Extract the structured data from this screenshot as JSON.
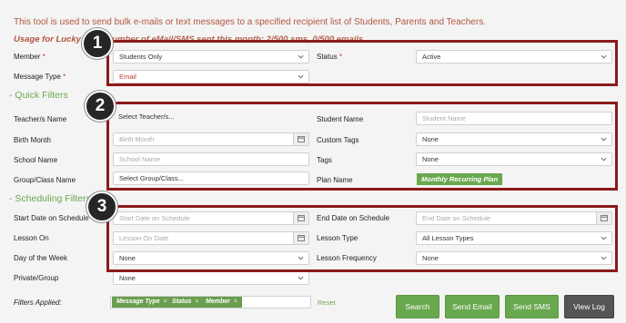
{
  "intro_text": "This tool is used to send bulk e-mails or text messages to a specified recipient list of Students, Parents and Teachers.",
  "usage_text": "Usage for Lucky S",
  "usage_rest": "otal number of eMail/SMS sent this month: 2/500 sms, 0/500 emails",
  "top": {
    "member_label": "Member",
    "member_value": "Students Only",
    "status_label": "Status",
    "status_value": "Active",
    "message_type_label": "Message Type",
    "message_type_value": "Email",
    "required_mark": "*"
  },
  "quick_filters": {
    "title": "- Quick Filters",
    "teacher_label": "Teacher/s Name",
    "teacher_placeholder": "Select Teacher/s...",
    "student_label": "Student Name",
    "student_placeholder": "Student Name",
    "birth_month_label": "Birth Month",
    "birth_month_placeholder": "Birth Month",
    "custom_tags_label": "Custom Tags",
    "custom_tags_value": "None",
    "school_label": "School Name",
    "school_placeholder": "School Name",
    "tags_label": "Tags",
    "tags_value": "None",
    "group_label": "Group/Class Name",
    "group_placeholder": "Select Group/Class...",
    "plan_label": "Plan Name",
    "plan_value": "Monthly Recurring Plan"
  },
  "scheduling": {
    "title": "- Scheduling Filters",
    "start_label": "Start Date on Schedule",
    "start_placeholder": "Start Date on Schedule",
    "end_label": "End Date on Schedule",
    "end_placeholder": "End Date on Schedule",
    "lesson_on_label": "Lesson On",
    "lesson_on_placeholder": "Lesson On Date",
    "lesson_type_label": "Lesson Type",
    "lesson_type_value": "All Lesson Types",
    "dow_label": "Day of the Week",
    "dow_value": "None",
    "freq_label": "Lesson Frequency",
    "freq_value": "None",
    "private_label": "Private/Group",
    "private_value": "None"
  },
  "filters_applied": {
    "label": "Filters Applied:",
    "chips": [
      "Message Type",
      "Status",
      "Member"
    ],
    "reset": "Reset"
  },
  "buttons": {
    "search": "Search",
    "send_email": "Send Email",
    "send_sms": "Send SMS",
    "view_log": "View Log"
  },
  "badges": [
    "1",
    "2",
    "3"
  ],
  "colors": {
    "accent_green": "#6aa84f",
    "highlight_red": "#8b1a1a",
    "intro_text": "#b0563f"
  }
}
